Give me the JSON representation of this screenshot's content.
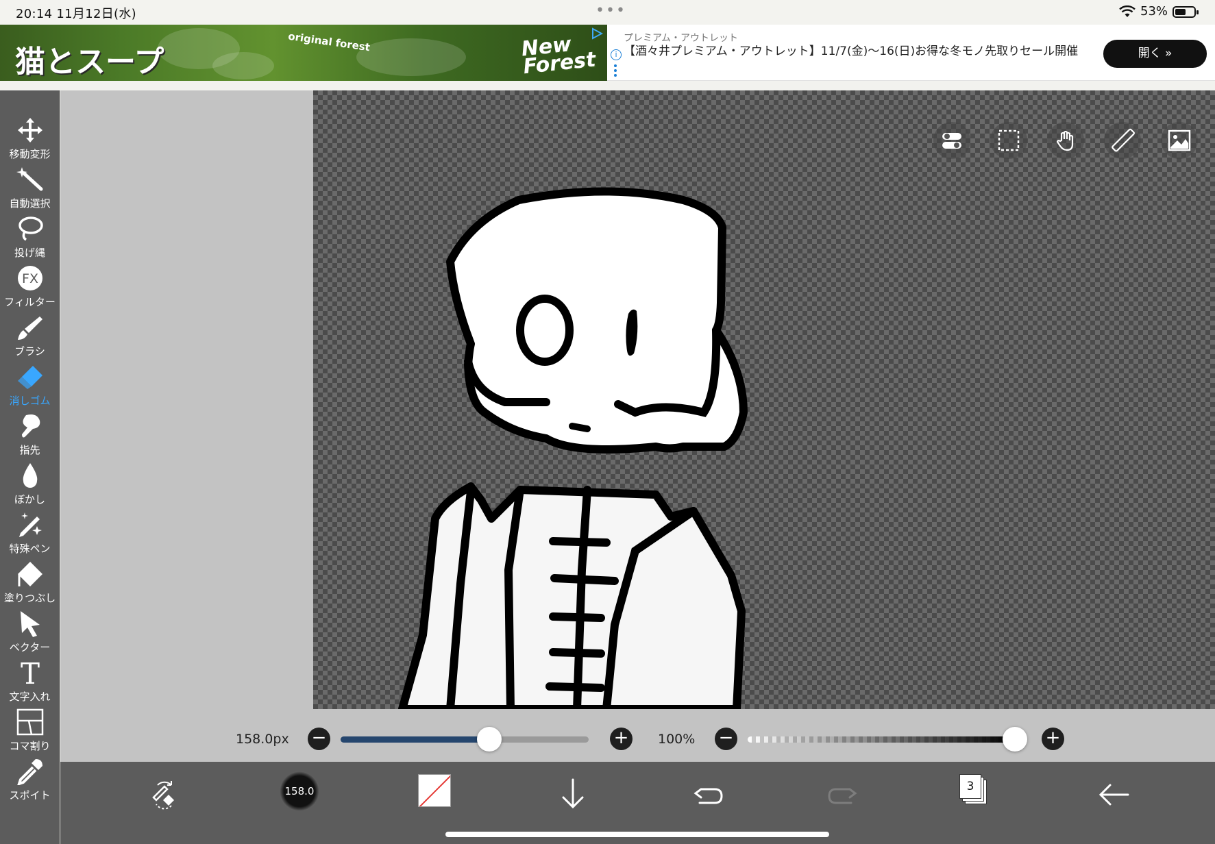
{
  "status_bar": {
    "time": "20:14",
    "date": "11月12日(水)",
    "multitask": "•••",
    "battery": "53%",
    "battery_level": 0.53
  },
  "ad": {
    "game_title": "猫とスープ",
    "game_sub": "original forest",
    "game_logo_line1": "New",
    "game_logo_line2": "Forest",
    "sponsor": "プレミアム・アウトレット",
    "headline": "【酒々井プレミアム・アウトレット】11/7(金)〜16(日)お得な冬モノ先取りセール開催",
    "cta": "開く »"
  },
  "tools": [
    {
      "label": "移動変形",
      "icon": "move-icon"
    },
    {
      "label": "自動選択",
      "icon": "magic-wand-icon"
    },
    {
      "label": "投げ縄",
      "icon": "lasso-icon"
    },
    {
      "label": "フィルター",
      "icon": "fx-filter-icon"
    },
    {
      "label": "ブラシ",
      "icon": "brush-icon"
    },
    {
      "label": "消しゴム",
      "icon": "eraser-icon",
      "active": true
    },
    {
      "label": "指先",
      "icon": "finger-icon"
    },
    {
      "label": "ぼかし",
      "icon": "blur-drop-icon"
    },
    {
      "label": "特殊ペン",
      "icon": "special-pen-icon"
    },
    {
      "label": "塗りつぶし",
      "icon": "fill-bucket-icon"
    },
    {
      "label": "ベクター",
      "icon": "vector-cursor-icon"
    },
    {
      "label": "文字入れ",
      "icon": "text-icon"
    },
    {
      "label": "コマ割り",
      "icon": "panel-divide-icon"
    },
    {
      "label": "スポイト",
      "icon": "eyedropper-icon"
    }
  ],
  "canvas_tools": [
    "toggle-settings-icon",
    "selection-icon",
    "hand-tool-icon",
    "ruler-icon",
    "reference-image-icon"
  ],
  "brush": {
    "size_label": "158.0px",
    "size_value": 158.0,
    "size_fraction": 0.6,
    "preview_label": "158.0",
    "opacity_label": "100%",
    "opacity_fraction": 1.0
  },
  "bottom_bar": {
    "layer_count": "3"
  },
  "colors": {
    "accent": "#39a7ff",
    "slider_fill": "#25466e",
    "toolbar_bg": "#5c5c5c",
    "work_bg": "#c3c3c3"
  }
}
